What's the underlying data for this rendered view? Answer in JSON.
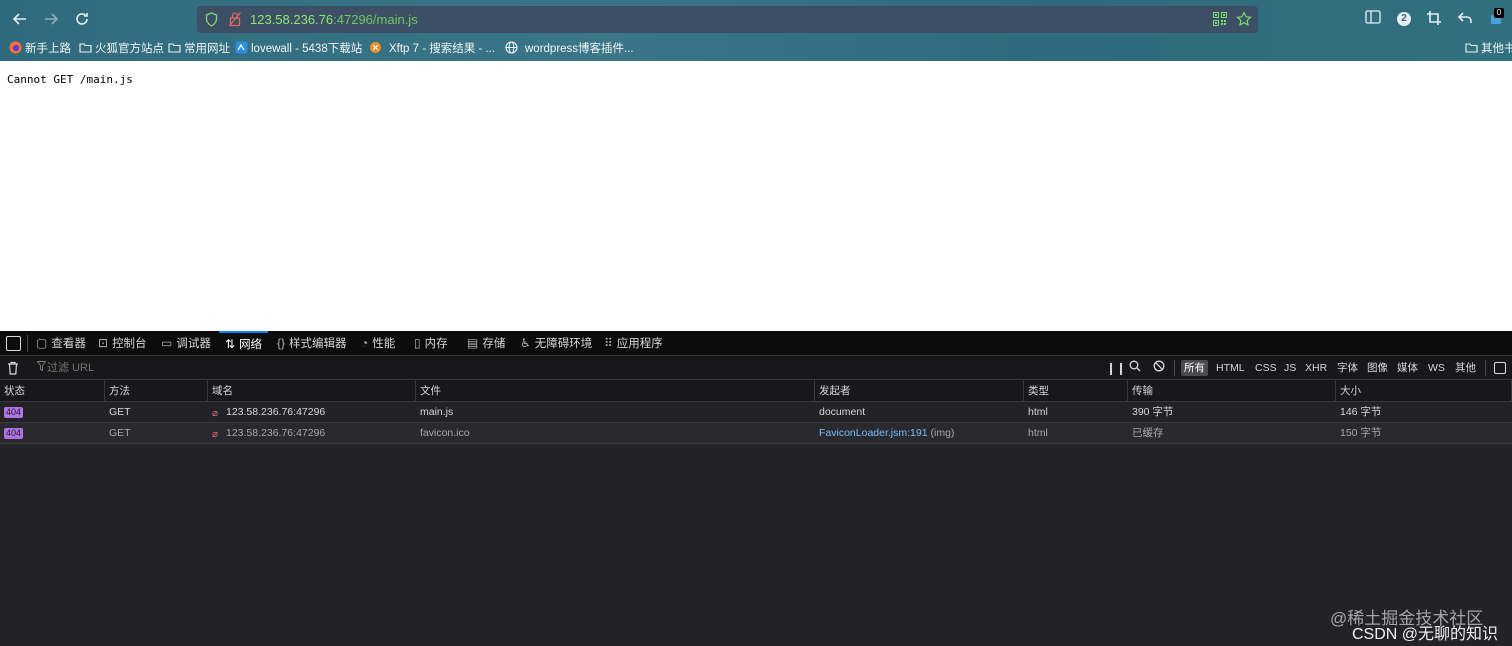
{
  "browser": {
    "url_host": "123.58.236.76",
    "url_rest": ":47296/main.js",
    "toolbar_badge": "2",
    "extension_count": "0",
    "bookmarks": [
      {
        "label": "新手上路",
        "icon": "firefox-icon"
      },
      {
        "label": "火狐官方站点",
        "icon": "folder-icon"
      },
      {
        "label": "常用网址",
        "icon": "folder-icon"
      },
      {
        "label": "lovewall - 5438下载站",
        "icon": "site-icon"
      },
      {
        "label": "Xftp 7 - 搜索结果 - ...",
        "icon": "xftp-icon"
      },
      {
        "label": "wordpress博客插件...",
        "icon": "globe-icon"
      },
      {
        "label": "其他书",
        "icon": "folder-icon"
      }
    ]
  },
  "page": {
    "message": "Cannot GET /main.js"
  },
  "devtools": {
    "tabs": [
      {
        "label": "查看器",
        "icon": "inspector-icon"
      },
      {
        "label": "控制台",
        "icon": "console-icon"
      },
      {
        "label": "调试器",
        "icon": "debugger-icon"
      },
      {
        "label": "网络",
        "icon": "network-icon",
        "active": true
      },
      {
        "label": "样式编辑器",
        "icon": "style-editor-icon"
      },
      {
        "label": "性能",
        "icon": "performance-icon"
      },
      {
        "label": "内存",
        "icon": "memory-icon"
      },
      {
        "label": "存储",
        "icon": "storage-icon"
      },
      {
        "label": "无障碍环境",
        "icon": "accessibility-icon"
      },
      {
        "label": "应用程序",
        "icon": "application-icon"
      }
    ],
    "filter_placeholder": "过滤 URL",
    "filter_types": [
      "所有",
      "HTML",
      "CSS",
      "JS",
      "XHR",
      "字体",
      "图像",
      "媒体",
      "WS",
      "其他"
    ],
    "active_filter": "所有",
    "columns": [
      "状态",
      "方法",
      "域名",
      "文件",
      "发起者",
      "类型",
      "传输",
      "大小"
    ],
    "requests": [
      {
        "status": "404",
        "method": "GET",
        "domain": "123.58.236.76:47296",
        "file": "main.js",
        "initiator": "document",
        "initiator_extra": "",
        "type": "html",
        "transferred": "390 字节",
        "size": "146 字节"
      },
      {
        "status": "404",
        "method": "GET",
        "domain": "123.58.236.76:47296",
        "file": "favicon.ico",
        "initiator": "FaviconLoader.jsm:191",
        "initiator_extra": "(img)",
        "type": "html",
        "transferred": "已缓存",
        "size": "150 字节"
      }
    ]
  },
  "watermark": {
    "line1": "@稀土掘金技术社区",
    "line2": "CSDN @无聊的知识"
  }
}
